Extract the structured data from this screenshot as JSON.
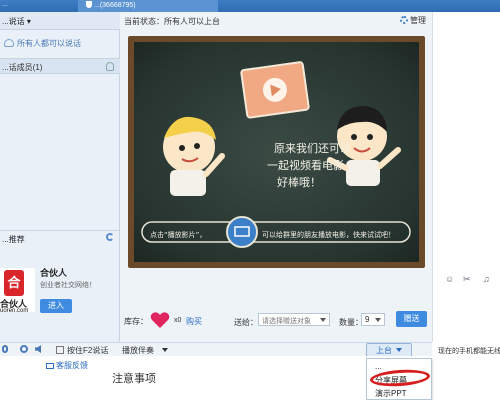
{
  "topbar": {
    "tab1": "...",
    "tab2": "...(36668795)"
  },
  "left": {
    "mode": "...说话 ▾",
    "everyone": "所有人都可以说话",
    "members": "...话成员(1)",
    "recommend": "...推荐",
    "promo": {
      "logo_text": "合",
      "logo_name": "合伙人",
      "logo_domain": "uoren.com",
      "title": "合伙人",
      "subtitle": "创业者社交网络！",
      "button": "进入"
    }
  },
  "main": {
    "status": "当前状态：所有人可以上台",
    "manage": "管理",
    "board": {
      "line1": "原来我们还可以",
      "line2": "一起视频看电影",
      "line3": "好棒哦！",
      "hint_left": "点击“播放影片”，",
      "hint_right": "可以给群里的朋友播放电影，快来试试吧！"
    },
    "gift": {
      "stock_label": "库存：",
      "count": "x0",
      "buy": "购买",
      "give_label": "送给：",
      "give_placeholder": "请选择赠送对象",
      "qty_label": "数量：",
      "qty_value": "9",
      "give_button": "赠送"
    }
  },
  "toolbar": {
    "f2_label": "按住F2说话",
    "accompany": "播放伴奏",
    "onstage": "上台",
    "phone_note": "现在的手机都能无线..."
  },
  "below": {
    "feedback": "客服反馈",
    "notes": "注意事项"
  },
  "menu": {
    "item1": "...",
    "item2": "分享屏幕",
    "item3": "演示PPT"
  },
  "colors": {
    "accent": "#3e8be0",
    "board": "#273430",
    "frame": "#6b4a2a",
    "highlight": "#d61e1e"
  }
}
